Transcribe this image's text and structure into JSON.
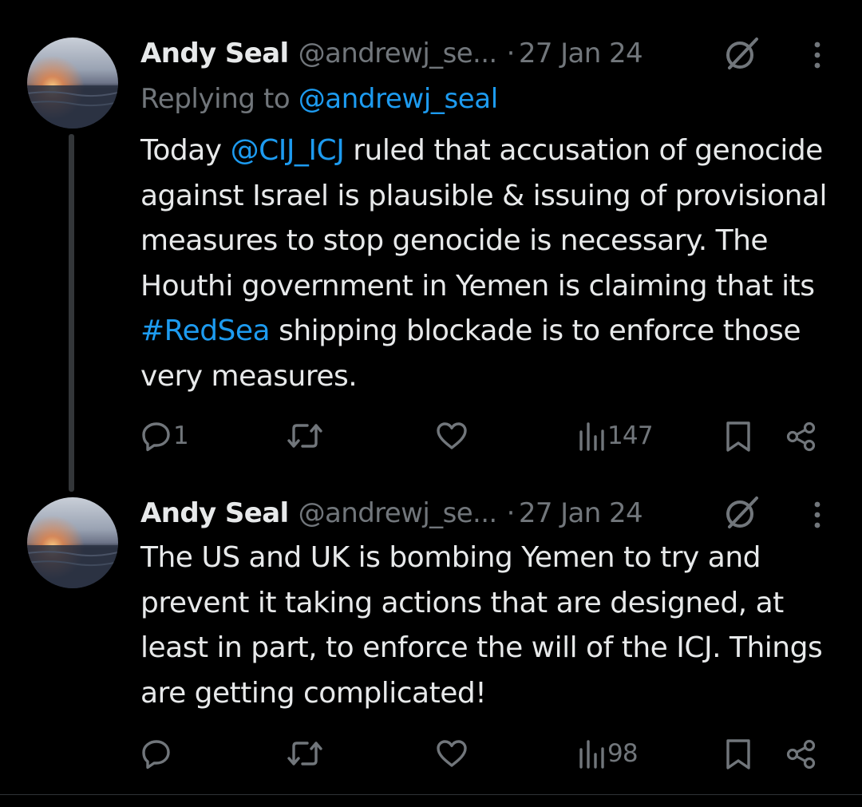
{
  "tweets": [
    {
      "name": "Andy Seal",
      "handle": "@andrewj_se...",
      "separator": "·",
      "date": "27 Jan 24",
      "replying_prefix": "Replying to ",
      "replying_to": "@andrewj_seal",
      "text_parts": [
        "Today ",
        "@CIJ_ICJ",
        " ruled that accusation of genocide against Israel is plausible & issuing of provisional measures to stop genocide is necessary. The Houthi government in Yemen is claiming that its ",
        "#RedSea",
        " shipping blockade is to enforce those very measures."
      ],
      "reply_count": "1",
      "retweet_count": "",
      "like_count": "",
      "view_count": "147"
    },
    {
      "name": "Andy Seal",
      "handle": "@andrewj_se...",
      "separator": "·",
      "date": "27 Jan 24",
      "text": "The US and UK is bombing Yemen to try and prevent it taking actions that are designed, at least in part, to enforce the will of the ICJ. Things are getting complicated!",
      "reply_count": "",
      "retweet_count": "",
      "like_count": "",
      "view_count": "98"
    }
  ],
  "colors": {
    "background": "#000000",
    "text": "#e7e9ea",
    "muted": "#71767b",
    "link": "#1d9bf0",
    "thread_line": "#333639"
  },
  "icons": {
    "reply": "reply-icon",
    "retweet": "retweet-icon",
    "like": "heart-icon",
    "views": "views-icon",
    "bookmark": "bookmark-icon",
    "share": "share-icon",
    "grok": "grok-icon",
    "more": "more-vertical-icon"
  }
}
